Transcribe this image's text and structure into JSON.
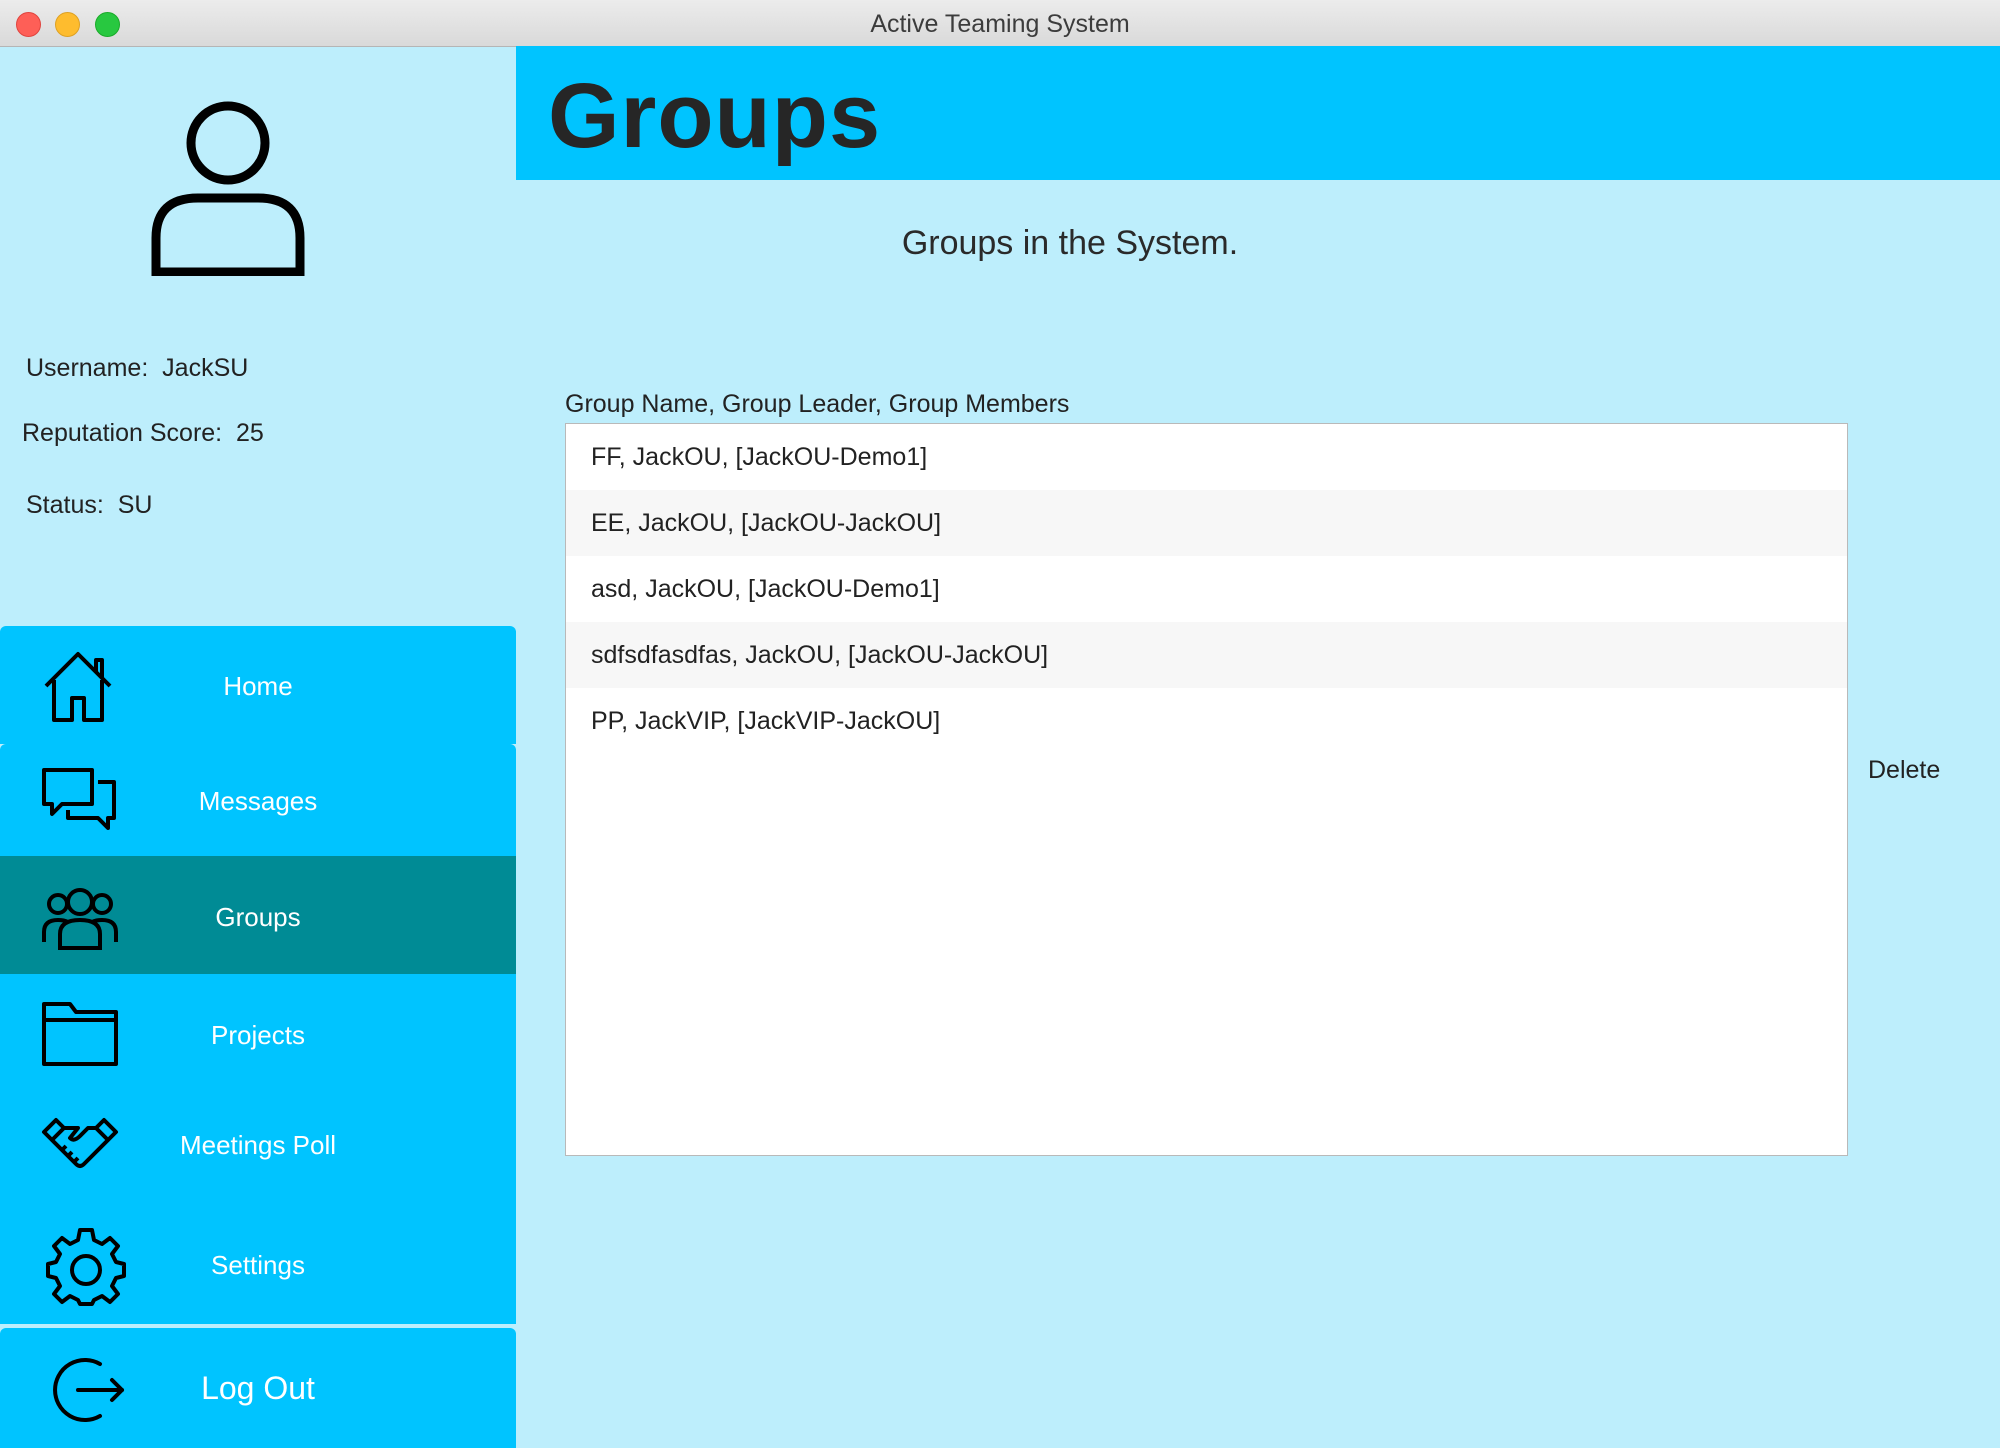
{
  "window": {
    "title": "Active Teaming System"
  },
  "profile": {
    "username_label": "Username:",
    "username": "JackSU",
    "reputation_label": "Reputation Score:",
    "reputation": "25",
    "status_label": "Status:",
    "status": "SU"
  },
  "nav": {
    "items": [
      {
        "label": "Home",
        "icon": "home-icon"
      },
      {
        "label": "Messages",
        "icon": "messages-icon"
      },
      {
        "label": "Groups",
        "icon": "groups-icon",
        "active": true
      },
      {
        "label": "Projects",
        "icon": "folder-icon"
      },
      {
        "label": "Meetings Poll",
        "icon": "handshake-icon"
      },
      {
        "label": "Settings",
        "icon": "gear-icon"
      },
      {
        "label": "Log Out",
        "icon": "logout-icon"
      }
    ]
  },
  "main": {
    "title": "Groups",
    "subtitle": "Groups in the System.",
    "list_label": "Group Name, Group Leader, Group Members",
    "rows": [
      "FF, JackOU, [JackOU-Demo1]",
      "EE, JackOU, [JackOU-JackOU]",
      "asd, JackOU, [JackOU-Demo1]",
      "sdfsdfasdfas, JackOU, [JackOU-JackOU]",
      "PP, JackVIP, [JackVIP-JackOU]"
    ],
    "delete_label": "Delete"
  },
  "colors": {
    "background": "#bdeefc",
    "accent": "#00c4ff",
    "active_nav": "#008b95"
  }
}
